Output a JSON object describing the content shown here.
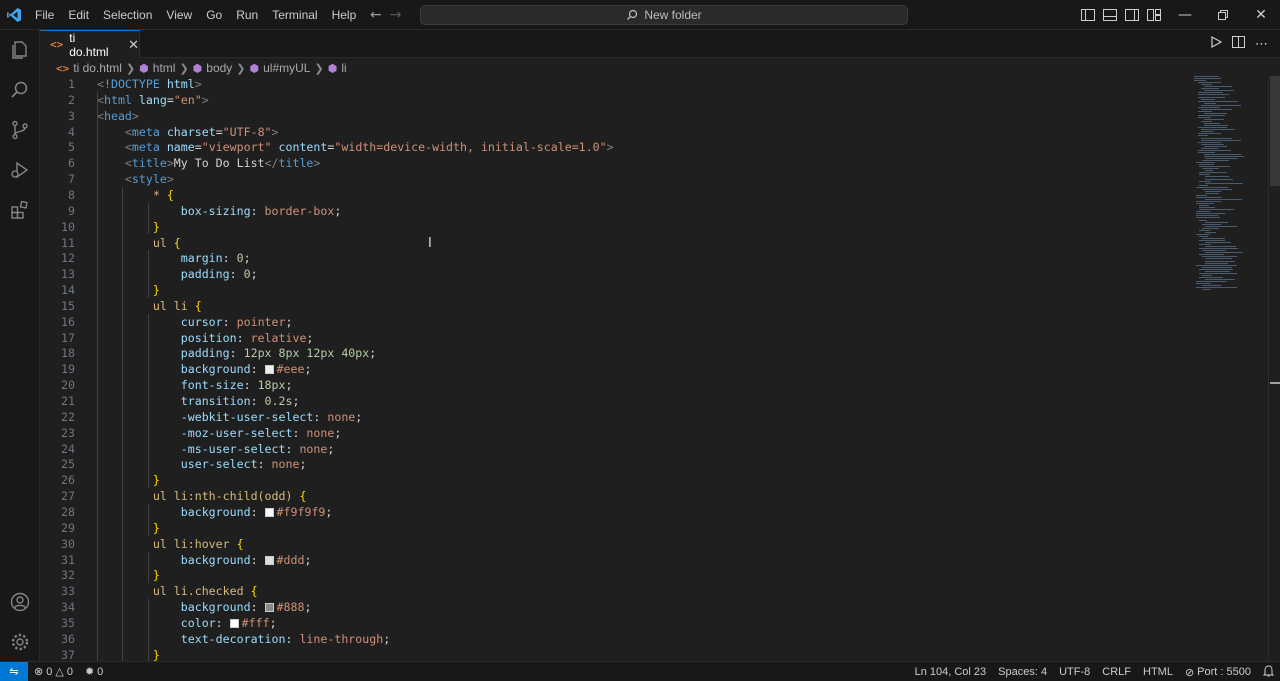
{
  "menu": [
    "File",
    "Edit",
    "Selection",
    "View",
    "Go",
    "Run",
    "Terminal",
    "Help"
  ],
  "command_center": {
    "label": "New folder",
    "icon": "search-icon"
  },
  "tab": {
    "filename": "ti do.html",
    "icon": "html-file-icon"
  },
  "breadcrumbs": [
    {
      "label": "ti do.html",
      "icon": "html-file-icon"
    },
    {
      "label": "html",
      "icon": "symbol-element-icon"
    },
    {
      "label": "body",
      "icon": "symbol-element-icon"
    },
    {
      "label": "ul#myUL",
      "icon": "symbol-element-icon"
    },
    {
      "label": "li",
      "icon": "symbol-element-icon"
    }
  ],
  "code_lines": [
    [
      [
        "t-br",
        "<"
      ],
      [
        "t-tag",
        "!DOCTYPE"
      ],
      [
        "t-text",
        " "
      ],
      [
        "t-attr",
        "html"
      ],
      [
        "t-br",
        ">"
      ]
    ],
    [
      [
        "t-br",
        "<"
      ],
      [
        "t-tag",
        "html"
      ],
      [
        "t-text",
        " "
      ],
      [
        "t-attr",
        "lang"
      ],
      [
        "t-punc",
        "="
      ],
      [
        "t-str",
        "\"en\""
      ],
      [
        "t-br",
        ">"
      ]
    ],
    [
      [
        "t-br",
        "<"
      ],
      [
        "t-tag",
        "head"
      ],
      [
        "t-br",
        ">"
      ]
    ],
    [
      [
        "t-text",
        "    "
      ],
      [
        "t-br",
        "<"
      ],
      [
        "t-tag",
        "meta"
      ],
      [
        "t-text",
        " "
      ],
      [
        "t-attr",
        "charset"
      ],
      [
        "t-punc",
        "="
      ],
      [
        "t-str",
        "\"UTF-8\""
      ],
      [
        "t-br",
        ">"
      ]
    ],
    [
      [
        "t-text",
        "    "
      ],
      [
        "t-br",
        "<"
      ],
      [
        "t-tag",
        "meta"
      ],
      [
        "t-text",
        " "
      ],
      [
        "t-attr",
        "name"
      ],
      [
        "t-punc",
        "="
      ],
      [
        "t-str",
        "\"viewport\""
      ],
      [
        "t-text",
        " "
      ],
      [
        "t-attr",
        "content"
      ],
      [
        "t-punc",
        "="
      ],
      [
        "t-str",
        "\"width=device-width, initial-scale=1.0\""
      ],
      [
        "t-br",
        ">"
      ]
    ],
    [
      [
        "t-text",
        "    "
      ],
      [
        "t-br",
        "<"
      ],
      [
        "t-tag",
        "title"
      ],
      [
        "t-br",
        ">"
      ],
      [
        "t-text",
        "My To Do List"
      ],
      [
        "t-br",
        "</"
      ],
      [
        "t-tag",
        "title"
      ],
      [
        "t-br",
        ">"
      ]
    ],
    [
      [
        "t-text",
        "    "
      ],
      [
        "t-br",
        "<"
      ],
      [
        "t-tag",
        "style"
      ],
      [
        "t-br",
        ">"
      ]
    ],
    [
      [
        "t-text",
        "        "
      ],
      [
        "t-sel",
        "*"
      ],
      [
        "t-text",
        " "
      ],
      [
        "t-brace",
        "{"
      ]
    ],
    [
      [
        "t-text",
        "            "
      ],
      [
        "t-prop",
        "box-sizing"
      ],
      [
        "t-punc",
        ": "
      ],
      [
        "t-val",
        "border-box"
      ],
      [
        "t-punc",
        ";"
      ]
    ],
    [
      [
        "t-text",
        "        "
      ],
      [
        "t-brace",
        "}"
      ]
    ],
    [
      [
        "t-text",
        "        "
      ],
      [
        "t-sel",
        "ul"
      ],
      [
        "t-text",
        " "
      ],
      [
        "t-brace",
        "{"
      ]
    ],
    [
      [
        "t-text",
        "            "
      ],
      [
        "t-prop",
        "margin"
      ],
      [
        "t-punc",
        ": "
      ],
      [
        "t-num",
        "0"
      ],
      [
        "t-punc",
        ";"
      ]
    ],
    [
      [
        "t-text",
        "            "
      ],
      [
        "t-prop",
        "padding"
      ],
      [
        "t-punc",
        ": "
      ],
      [
        "t-num",
        "0"
      ],
      [
        "t-punc",
        ";"
      ]
    ],
    [
      [
        "t-text",
        "        "
      ],
      [
        "t-brace",
        "}"
      ]
    ],
    [
      [
        "t-text",
        "        "
      ],
      [
        "t-sel",
        "ul li"
      ],
      [
        "t-text",
        " "
      ],
      [
        "t-brace",
        "{"
      ]
    ],
    [
      [
        "t-text",
        "            "
      ],
      [
        "t-prop",
        "cursor"
      ],
      [
        "t-punc",
        ": "
      ],
      [
        "t-val",
        "pointer"
      ],
      [
        "t-punc",
        ";"
      ]
    ],
    [
      [
        "t-text",
        "            "
      ],
      [
        "t-prop",
        "position"
      ],
      [
        "t-punc",
        ": "
      ],
      [
        "t-val",
        "relative"
      ],
      [
        "t-punc",
        ";"
      ]
    ],
    [
      [
        "t-text",
        "            "
      ],
      [
        "t-prop",
        "padding"
      ],
      [
        "t-punc",
        ": "
      ],
      [
        "t-num",
        "12px 8px 12px 40px"
      ],
      [
        "t-punc",
        ";"
      ]
    ],
    [
      [
        "t-text",
        "            "
      ],
      [
        "t-prop",
        "background"
      ],
      [
        "t-punc",
        ": "
      ],
      [
        "swatch",
        "#eee"
      ],
      [
        "t-val",
        "#eee"
      ],
      [
        "t-punc",
        ";"
      ]
    ],
    [
      [
        "t-text",
        "            "
      ],
      [
        "t-prop",
        "font-size"
      ],
      [
        "t-punc",
        ": "
      ],
      [
        "t-num",
        "18px"
      ],
      [
        "t-punc",
        ";"
      ]
    ],
    [
      [
        "t-text",
        "            "
      ],
      [
        "t-prop",
        "transition"
      ],
      [
        "t-punc",
        ": "
      ],
      [
        "t-num",
        "0.2s"
      ],
      [
        "t-punc",
        ";"
      ]
    ],
    [
      [
        "t-text",
        "            "
      ],
      [
        "t-prop",
        "-webkit-user-select"
      ],
      [
        "t-punc",
        ": "
      ],
      [
        "t-val",
        "none"
      ],
      [
        "t-punc",
        ";"
      ]
    ],
    [
      [
        "t-text",
        "            "
      ],
      [
        "t-prop",
        "-moz-user-select"
      ],
      [
        "t-punc",
        ": "
      ],
      [
        "t-val",
        "none"
      ],
      [
        "t-punc",
        ";"
      ]
    ],
    [
      [
        "t-text",
        "            "
      ],
      [
        "t-prop",
        "-ms-user-select"
      ],
      [
        "t-punc",
        ": "
      ],
      [
        "t-val",
        "none"
      ],
      [
        "t-punc",
        ";"
      ]
    ],
    [
      [
        "t-text",
        "            "
      ],
      [
        "t-prop",
        "user-select"
      ],
      [
        "t-punc",
        ": "
      ],
      [
        "t-val",
        "none"
      ],
      [
        "t-punc",
        ";"
      ]
    ],
    [
      [
        "t-text",
        "        "
      ],
      [
        "t-brace",
        "}"
      ]
    ],
    [
      [
        "t-text",
        "        "
      ],
      [
        "t-sel",
        "ul li:nth-child(odd)"
      ],
      [
        "t-text",
        " "
      ],
      [
        "t-brace",
        "{"
      ]
    ],
    [
      [
        "t-text",
        "            "
      ],
      [
        "t-prop",
        "background"
      ],
      [
        "t-punc",
        ": "
      ],
      [
        "swatch",
        "#f9f9f9"
      ],
      [
        "t-val",
        "#f9f9f9"
      ],
      [
        "t-punc",
        ";"
      ]
    ],
    [
      [
        "t-text",
        "        "
      ],
      [
        "t-brace",
        "}"
      ]
    ],
    [
      [
        "t-text",
        "        "
      ],
      [
        "t-sel",
        "ul li:hover"
      ],
      [
        "t-text",
        " "
      ],
      [
        "t-brace",
        "{"
      ]
    ],
    [
      [
        "t-text",
        "            "
      ],
      [
        "t-prop",
        "background"
      ],
      [
        "t-punc",
        ": "
      ],
      [
        "swatch",
        "#ddd"
      ],
      [
        "t-val",
        "#ddd"
      ],
      [
        "t-punc",
        ";"
      ]
    ],
    [
      [
        "t-text",
        "        "
      ],
      [
        "t-brace",
        "}"
      ]
    ],
    [
      [
        "t-text",
        "        "
      ],
      [
        "t-sel",
        "ul li.checked"
      ],
      [
        "t-text",
        " "
      ],
      [
        "t-brace",
        "{"
      ]
    ],
    [
      [
        "t-text",
        "            "
      ],
      [
        "t-prop",
        "background"
      ],
      [
        "t-punc",
        ": "
      ],
      [
        "swatch",
        "#888"
      ],
      [
        "t-val",
        "#888"
      ],
      [
        "t-punc",
        ";"
      ]
    ],
    [
      [
        "t-text",
        "            "
      ],
      [
        "t-prop",
        "color"
      ],
      [
        "t-punc",
        ": "
      ],
      [
        "swatch",
        "#fff"
      ],
      [
        "t-val",
        "#fff"
      ],
      [
        "t-punc",
        ";"
      ]
    ],
    [
      [
        "t-text",
        "            "
      ],
      [
        "t-prop",
        "text-decoration"
      ],
      [
        "t-punc",
        ": "
      ],
      [
        "t-val",
        "line-through"
      ],
      [
        "t-punc",
        ";"
      ]
    ],
    [
      [
        "t-text",
        "        "
      ],
      [
        "t-brace",
        "}"
      ]
    ]
  ],
  "statusbar": {
    "errors": "0",
    "warnings": "0",
    "ports": "0",
    "cursor_position": "Ln 104, Col 23",
    "indentation": "Spaces: 4",
    "encoding": "UTF-8",
    "eol": "CRLF",
    "language": "HTML",
    "live_server": "Port : 5500"
  },
  "colors": {
    "accent": "#0078d4",
    "background": "#1f1f1f",
    "chrome": "#181818"
  }
}
